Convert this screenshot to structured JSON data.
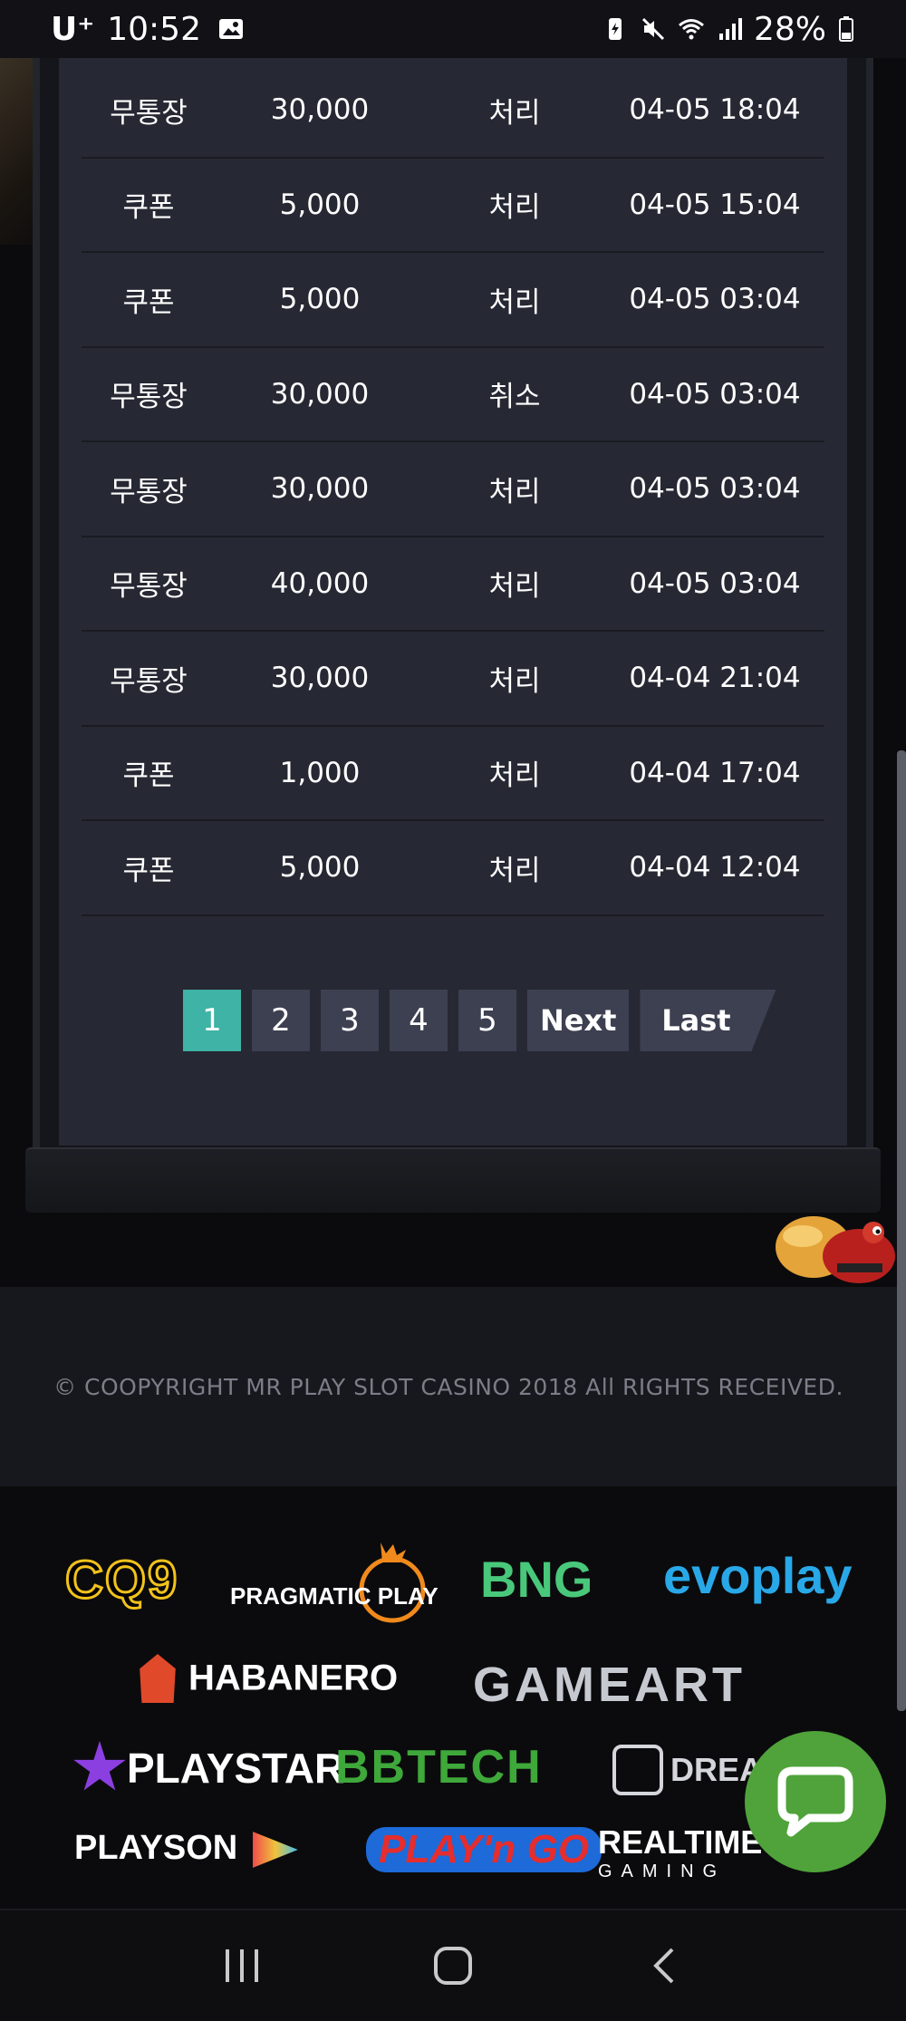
{
  "status_bar": {
    "carrier": "U⁺",
    "time": "10:52",
    "battery": "28%",
    "icons": [
      "gallery-icon",
      "battery-saver-icon",
      "mute-icon",
      "wifi-icon",
      "signal-icon",
      "battery-icon"
    ]
  },
  "table": {
    "rows": [
      {
        "type": "무통장",
        "amount": "30,000",
        "status": "처리",
        "date": "04-05 18:04"
      },
      {
        "type": "쿠폰",
        "amount": "5,000",
        "status": "처리",
        "date": "04-05 15:04"
      },
      {
        "type": "쿠폰",
        "amount": "5,000",
        "status": "처리",
        "date": "04-05 03:04"
      },
      {
        "type": "무통장",
        "amount": "30,000",
        "status": "취소",
        "date": "04-05 03:04"
      },
      {
        "type": "무통장",
        "amount": "30,000",
        "status": "처리",
        "date": "04-05 03:04"
      },
      {
        "type": "무통장",
        "amount": "40,000",
        "status": "처리",
        "date": "04-05 03:04"
      },
      {
        "type": "무통장",
        "amount": "30,000",
        "status": "처리",
        "date": "04-04 21:04"
      },
      {
        "type": "쿠폰",
        "amount": "1,000",
        "status": "처리",
        "date": "04-04 17:04"
      },
      {
        "type": "쿠폰",
        "amount": "5,000",
        "status": "처리",
        "date": "04-04 12:04"
      }
    ]
  },
  "pagination": {
    "pages": [
      "1",
      "2",
      "3",
      "4",
      "5"
    ],
    "current": "1",
    "next": "Next",
    "last": "Last"
  },
  "footer": {
    "copyright": "© COOPYRIGHT MR PLAY SLOT CASINO 2018 All RIGHTS RECEIVED."
  },
  "providers": {
    "cq9": "CQ9",
    "pragmatic": "PRAGMATIC PLAY",
    "bng": "BNG",
    "evoplay": "evoplay",
    "habanero": "HABANERO",
    "gameart": "GAMEART",
    "playstar": "PLAYSTAR",
    "bbtech": "BBTECH",
    "dream": "DREAM",
    "playson": "PLAYSON",
    "playngo": "PLAY'n GO",
    "realtime": "REALTIME",
    "realtime_sub": "GAMING"
  },
  "colors": {
    "accent": "#3eb3a6",
    "panel": "#262833",
    "page_button": "#3d4051",
    "chat": "#4fa33a"
  }
}
